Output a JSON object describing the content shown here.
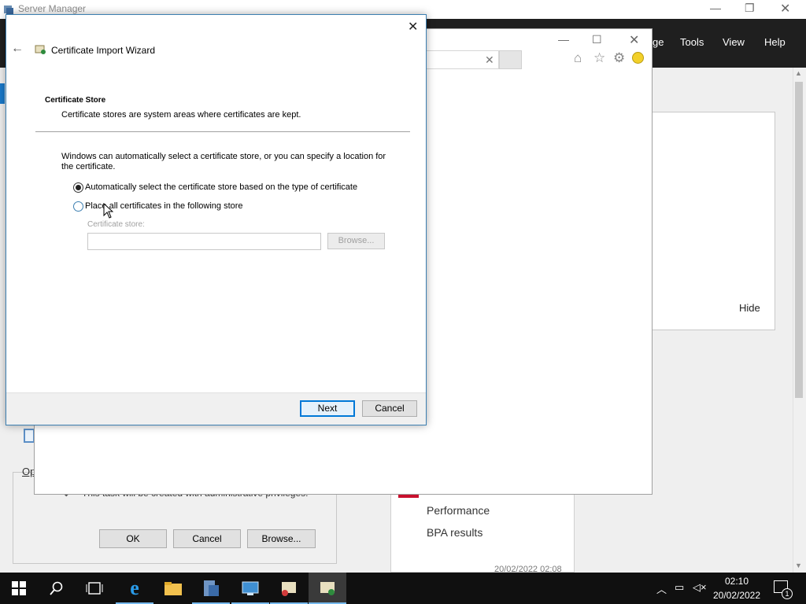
{
  "server_manager": {
    "title": "Server Manager",
    "menu": [
      "ge",
      "Tools",
      "View",
      "Help"
    ],
    "hide_label": "Hide",
    "tile_items": [
      "Performance",
      "BPA results"
    ],
    "timestamp_partial": "20/02/2022 02:08"
  },
  "task_dialog": {
    "link_partial": "Op",
    "note": "This task will be created with administrative privileges.",
    "buttons": {
      "ok": "OK",
      "cancel": "Cancel",
      "browse": "Browse..."
    }
  },
  "wizard": {
    "title": "Certificate Import Wizard",
    "section_heading": "Certificate Store",
    "section_desc": "Certificate stores are system areas where certificates are kept.",
    "intro": "Windows can automatically select a certificate store, or you can specify a location for the certificate.",
    "option_auto": "Automatically select the certificate store based on the type of certificate",
    "option_place": "Place all certificates in the following store",
    "selected_option": "auto",
    "store_label": "Certificate store:",
    "store_value": "",
    "browse_label": "Browse...",
    "next_label": "Next",
    "cancel_label": "Cancel"
  },
  "taskbar": {
    "time": "02:10",
    "date": "20/02/2022",
    "notification_count": "1",
    "icons": [
      "start-icon",
      "search-icon",
      "task-view-icon",
      "internet-explorer-icon",
      "file-explorer-icon",
      "server-manager-icon",
      "remote-desktop-icon",
      "certificate-tool-icon",
      "certificate-import-icon"
    ]
  },
  "colors": {
    "accent": "#0078d7",
    "taskbar": "#101010",
    "menubar": "#1f1f1f",
    "alert_red": "#c8102e"
  }
}
